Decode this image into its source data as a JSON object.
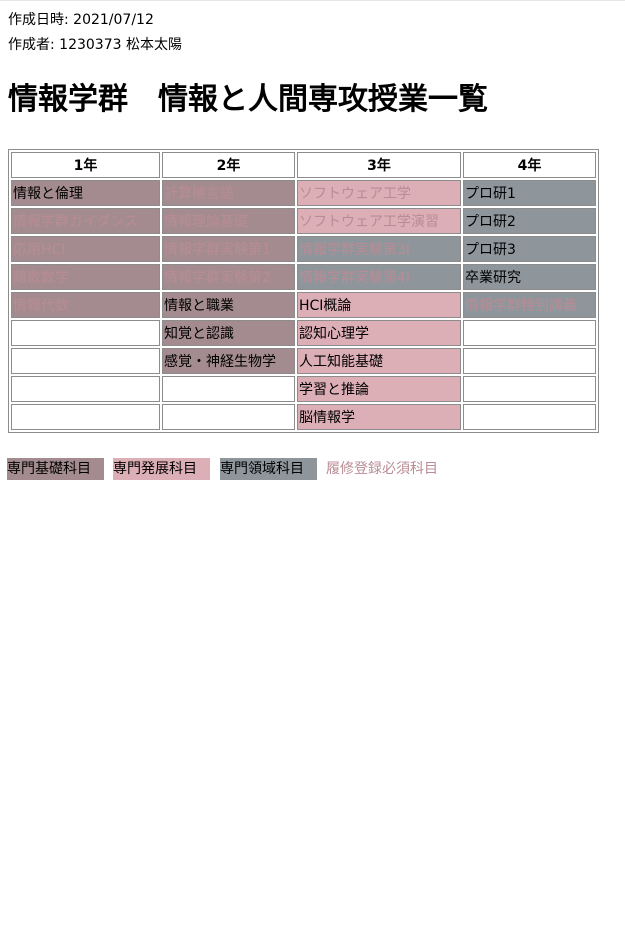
{
  "meta": {
    "created_date": "作成日時: 2021/07/12",
    "author": "作成者: 1230373 松本太陽"
  },
  "title": "情報学群　情報と人間専攻授業一覧",
  "table": {
    "headers": [
      "1年",
      "2年",
      "3年",
      "4年"
    ],
    "rows": [
      [
        {
          "text": "情報と倫理",
          "cat": "k",
          "req": false
        },
        {
          "text": "計算機言語",
          "cat": "k",
          "req": true
        },
        {
          "text": "ソフトウェア工学",
          "cat": "h",
          "req": true
        },
        {
          "text": "プロ研1",
          "cat": "r",
          "req": false
        }
      ],
      [
        {
          "text": "情報学群ガイダンス",
          "cat": "k",
          "req": true
        },
        {
          "text": "情報理論基礎",
          "cat": "k",
          "req": true
        },
        {
          "text": "ソフトウェア工学演習",
          "cat": "h",
          "req": true
        },
        {
          "text": "プロ研2",
          "cat": "r",
          "req": false
        }
      ],
      [
        {
          "text": "応用HCI",
          "cat": "k",
          "req": true
        },
        {
          "text": "情報学群実験第1",
          "cat": "k",
          "req": true
        },
        {
          "text": "情報学群実験第3I",
          "cat": "r",
          "req": true
        },
        {
          "text": "プロ研3",
          "cat": "r",
          "req": false
        }
      ],
      [
        {
          "text": "離散数学",
          "cat": "k",
          "req": true
        },
        {
          "text": "情報学群実験第2",
          "cat": "k",
          "req": true
        },
        {
          "text": "情報学群実験第4I",
          "cat": "r",
          "req": true
        },
        {
          "text": "卒業研究",
          "cat": "r",
          "req": false
        }
      ],
      [
        {
          "text": "情報代数",
          "cat": "k",
          "req": true
        },
        {
          "text": "情報と職業",
          "cat": "k",
          "req": false
        },
        {
          "text": "HCI概論",
          "cat": "h",
          "req": false
        },
        {
          "text": "情報学群特別講義",
          "cat": "r",
          "req": true
        }
      ],
      [
        {
          "text": "",
          "cat": "e",
          "req": false
        },
        {
          "text": "知覚と認識",
          "cat": "k",
          "req": false
        },
        {
          "text": "認知心理学",
          "cat": "h",
          "req": false
        },
        {
          "text": "",
          "cat": "e",
          "req": false
        }
      ],
      [
        {
          "text": "",
          "cat": "e",
          "req": false
        },
        {
          "text": "感覚・神経生物学",
          "cat": "k",
          "req": false
        },
        {
          "text": "人工知能基礎",
          "cat": "h",
          "req": false
        },
        {
          "text": "",
          "cat": "e",
          "req": false
        }
      ],
      [
        {
          "text": "",
          "cat": "e",
          "req": false
        },
        {
          "text": "",
          "cat": "e",
          "req": false
        },
        {
          "text": "学習と推論",
          "cat": "h",
          "req": false
        },
        {
          "text": "",
          "cat": "e",
          "req": false
        }
      ],
      [
        {
          "text": "",
          "cat": "e",
          "req": false
        },
        {
          "text": "",
          "cat": "e",
          "req": false
        },
        {
          "text": "脳情報学",
          "cat": "h",
          "req": false
        },
        {
          "text": "",
          "cat": "e",
          "req": false
        }
      ]
    ]
  },
  "legend": {
    "kiso": "専門基礎科目",
    "hatten": "専門発展科目",
    "ryoiki": "専門領域科目",
    "hissu": "履修登録必須科目"
  },
  "colors": {
    "kiso_bg": "#a38b8f",
    "hatten_bg": "#dcaeb6",
    "ryoiki_bg": "#8e969c",
    "required_text": "#b98c95"
  }
}
